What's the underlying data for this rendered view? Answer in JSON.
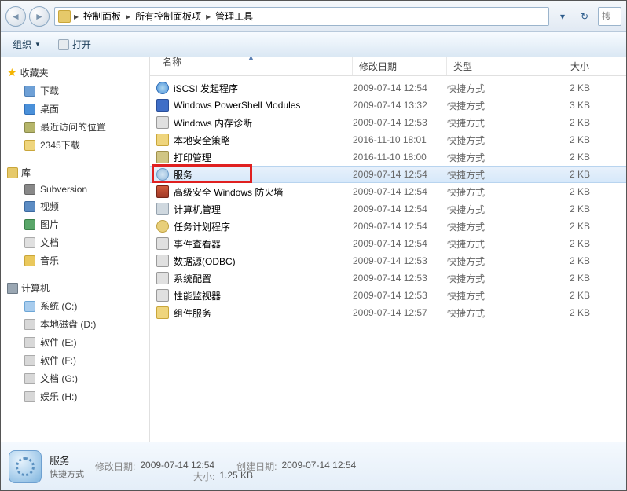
{
  "breadcrumb": {
    "items": [
      "控制面板",
      "所有控制面板项",
      "管理工具"
    ],
    "search_placeholder": "搜"
  },
  "toolbar": {
    "organize": "组织",
    "open": "打开"
  },
  "nav": {
    "favorites": {
      "label": "收藏夹",
      "items": [
        "下载",
        "桌面",
        "最近访问的位置",
        "2345下载"
      ]
    },
    "library": {
      "label": "库",
      "items": [
        "Subversion",
        "视频",
        "图片",
        "文档",
        "音乐"
      ]
    },
    "computer": {
      "label": "计算机",
      "items": [
        "系统 (C:)",
        "本地磁盘 (D:)",
        "软件 (E:)",
        "软件 (F:)",
        "文档 (G:)",
        "娱乐 (H:)"
      ]
    }
  },
  "columns": {
    "name": "名称",
    "date": "修改日期",
    "type": "类型",
    "size": "大小"
  },
  "files": [
    {
      "icon": "globe",
      "name": "iSCSI 发起程序",
      "date": "2009-07-14 12:54",
      "type": "快捷方式",
      "size": "2 KB"
    },
    {
      "icon": "ps",
      "name": "Windows PowerShell Modules",
      "date": "2009-07-14 13:32",
      "type": "快捷方式",
      "size": "3 KB"
    },
    {
      "icon": "mem",
      "name": "Windows 内存诊断",
      "date": "2009-07-14 12:53",
      "type": "快捷方式",
      "size": "2 KB"
    },
    {
      "icon": "pol",
      "name": "本地安全策略",
      "date": "2016-11-10 18:01",
      "type": "快捷方式",
      "size": "2 KB"
    },
    {
      "icon": "prn",
      "name": "打印管理",
      "date": "2016-11-10 18:00",
      "type": "快捷方式",
      "size": "2 KB"
    },
    {
      "icon": "gear",
      "name": "服务",
      "date": "2009-07-14 12:54",
      "type": "快捷方式",
      "size": "2 KB",
      "selected": true,
      "highlight": true
    },
    {
      "icon": "fw",
      "name": "高级安全 Windows 防火墙",
      "date": "2009-07-14 12:54",
      "type": "快捷方式",
      "size": "2 KB"
    },
    {
      "icon": "mgmt",
      "name": "计算机管理",
      "date": "2009-07-14 12:54",
      "type": "快捷方式",
      "size": "2 KB"
    },
    {
      "icon": "sched",
      "name": "任务计划程序",
      "date": "2009-07-14 12:54",
      "type": "快捷方式",
      "size": "2 KB"
    },
    {
      "icon": "ev",
      "name": "事件查看器",
      "date": "2009-07-14 12:54",
      "type": "快捷方式",
      "size": "2 KB"
    },
    {
      "icon": "db",
      "name": "数据源(ODBC)",
      "date": "2009-07-14 12:53",
      "type": "快捷方式",
      "size": "2 KB"
    },
    {
      "icon": "cfg",
      "name": "系统配置",
      "date": "2009-07-14 12:53",
      "type": "快捷方式",
      "size": "2 KB"
    },
    {
      "icon": "perf",
      "name": "性能监视器",
      "date": "2009-07-14 12:53",
      "type": "快捷方式",
      "size": "2 KB"
    },
    {
      "icon": "comp",
      "name": "组件服务",
      "date": "2009-07-14 12:57",
      "type": "快捷方式",
      "size": "2 KB"
    }
  ],
  "details": {
    "title": "服务",
    "sub": "快捷方式",
    "mod_label": "修改日期:",
    "mod_value": "2009-07-14 12:54",
    "create_label": "创建日期:",
    "create_value": "2009-07-14 12:54",
    "size_label": "大小:",
    "size_value": "1.25 KB"
  }
}
